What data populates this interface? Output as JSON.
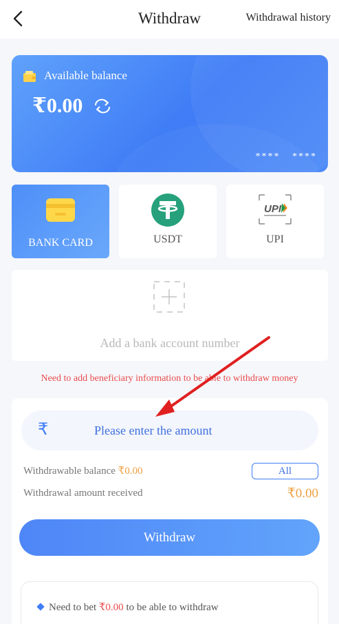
{
  "header": {
    "title": "Withdraw",
    "history_label": "Withdrawal history"
  },
  "balance_card": {
    "label": "Available balance",
    "amount": "₹0.00",
    "masked_number": "**** ****"
  },
  "methods": [
    {
      "label": "BANK CARD",
      "icon": "bank-card-icon",
      "active": true
    },
    {
      "label": "USDT",
      "icon": "tether-icon",
      "active": false
    },
    {
      "label": "UPI",
      "icon": "upi-logo",
      "active": false
    }
  ],
  "add_account": {
    "label": "Add a bank account number"
  },
  "warning": "Need to add beneficiary information to be able to withdraw money",
  "withdraw_form": {
    "currency_symbol": "₹",
    "amount_placeholder": "Please enter the amount",
    "withdrawable_label": "Withdrawable balance",
    "withdrawable_value": "₹0.00",
    "all_label": "All",
    "received_label": "Withdrawal amount received",
    "received_value": "₹0.00",
    "submit_label": "Withdraw"
  },
  "notes": [
    {
      "prefix": "Need to bet",
      "value": "₹0.00",
      "suffix": "to be able to withdraw"
    }
  ],
  "colors": {
    "accent": "#3f7cf6",
    "warning": "#e94a4a",
    "highlight": "#f0a040",
    "annotation_arrow": "#e02020"
  }
}
